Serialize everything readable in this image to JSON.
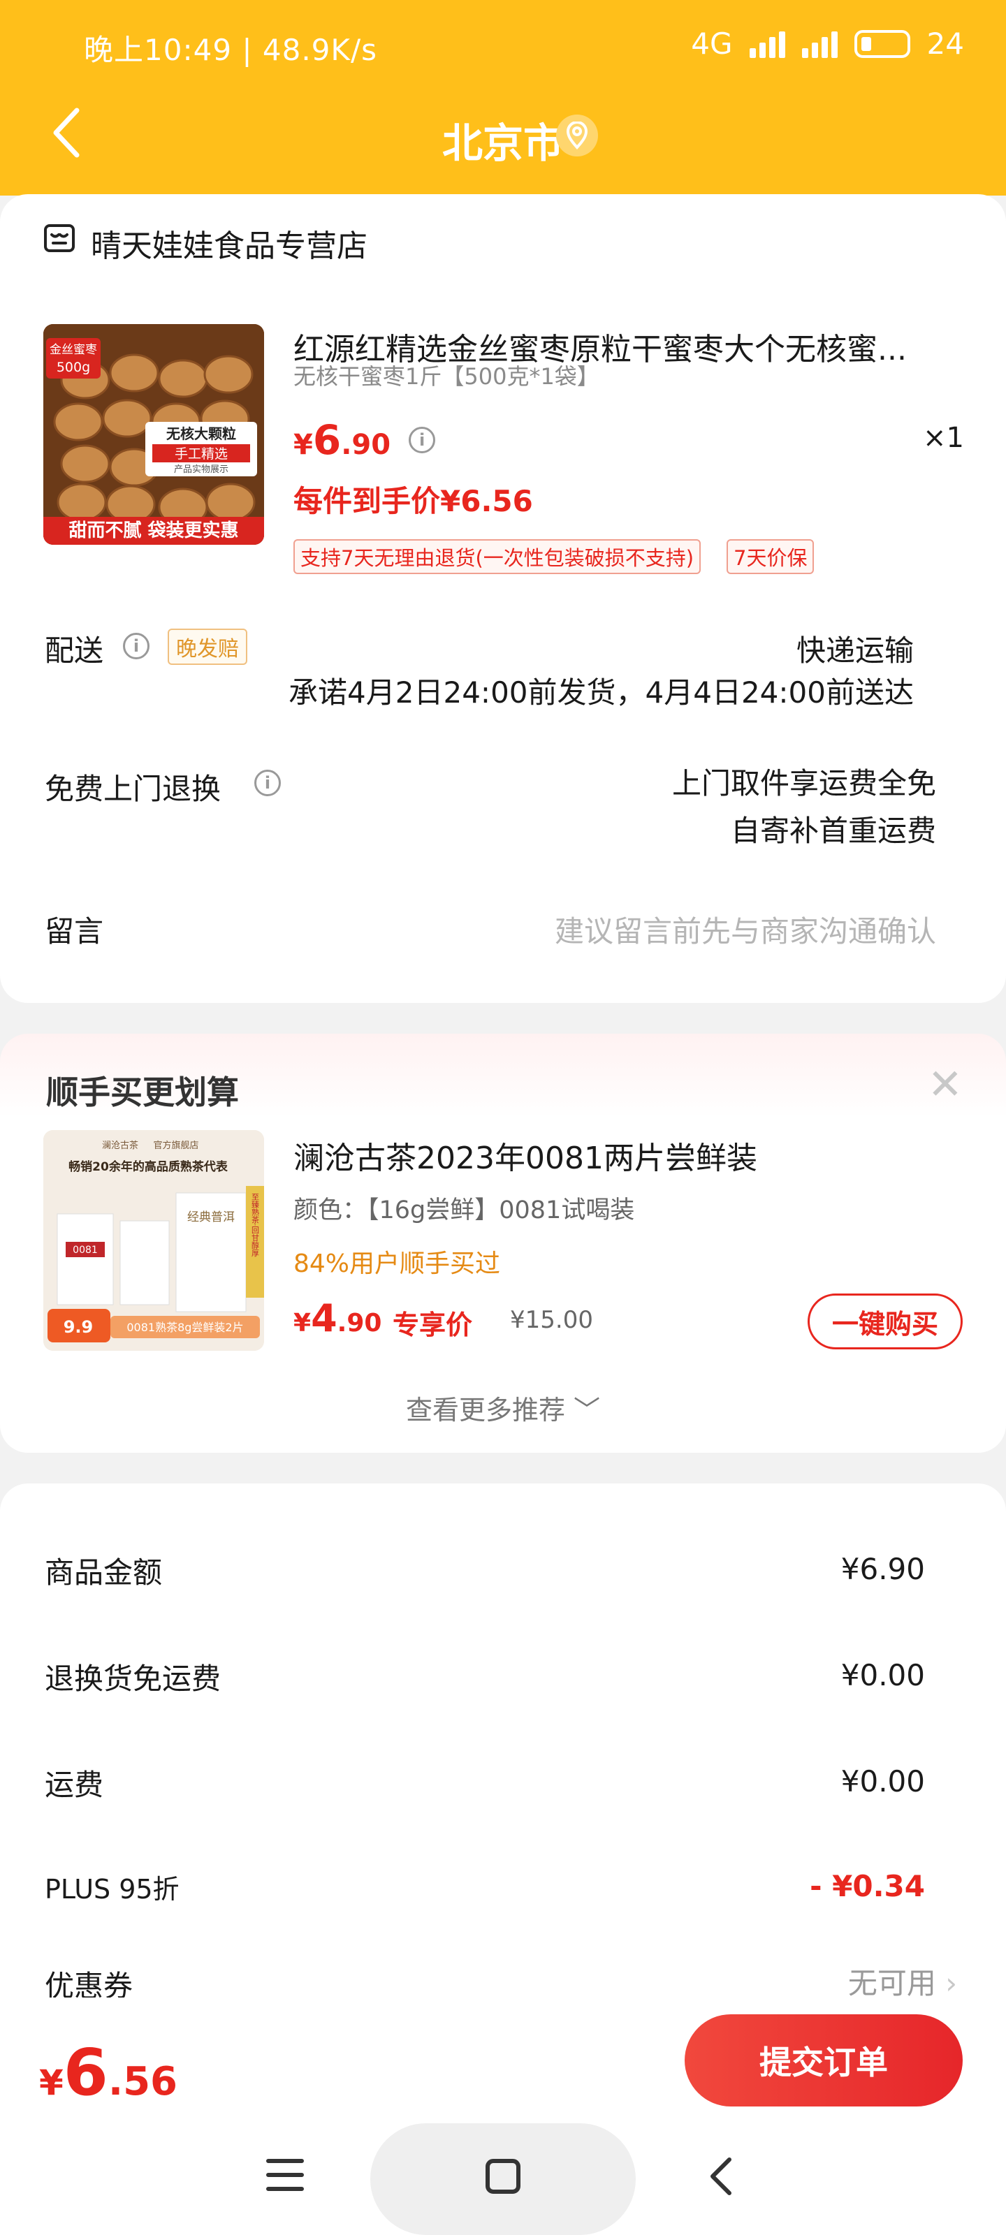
{
  "status": {
    "time": "晚上10:49 | 48.9K/s",
    "network": "4G",
    "battery": "24"
  },
  "nav": {
    "title": "北京市"
  },
  "store": {
    "name": "晴天娃娃食品专营店"
  },
  "product": {
    "image_texts": {
      "badge1": "金丝蜜枣",
      "badge2": "500g",
      "sticker1": "无核大颗粒",
      "sticker2": "手工精选",
      "sticker3": "产品实物展示",
      "bottom": "甜而不腻 袋装更实惠"
    },
    "title": "红源红精选金丝蜜枣原粒干蜜枣大个无核蜜...",
    "spec": "无核干蜜枣1斤【500克*1袋】",
    "price_symbol": "¥",
    "price_int": "6",
    "price_dec": ".90",
    "qty": "×1",
    "unit_price": "每件到手价¥6.56",
    "tags": [
      "支持7天无理由退货(一次性包装破损不支持)",
      "7天价保"
    ]
  },
  "delivery": {
    "label": "配送",
    "late_tag": "晚发赔",
    "method": "快递运输",
    "promise": "承诺4月2日24:00前发货，4月4日24:00前送达"
  },
  "return_service": {
    "label": "免费上门退换",
    "line1": "上门取件享运费全免",
    "line2": "自寄补首重运费"
  },
  "message": {
    "label": "留言",
    "hint": "建议留言前先与商家沟通确认"
  },
  "recommend": {
    "title": "顺手买更划算",
    "image_texts": {
      "brand": "澜沧古茶",
      "store": "官方旗舰店",
      "head": "畅销20余年的高品质熟茶代表",
      "mid": "经典普洱",
      "code": "0081",
      "side": "至臻熟茶·回甘醇厚",
      "price": "9.9",
      "foot": "0081熟茶8g尝鲜装2片"
    },
    "name": "澜沧古茶2023年0081两片尝鲜装",
    "color": "颜色：【16g尝鲜】0081试喝装",
    "bought": "84%用户顺手买过",
    "price_symbol": "¥",
    "price_int": "4",
    "price_dec": ".90",
    "exclusive": "专享价",
    "orig": "¥15.00",
    "buy": "一键购买",
    "more": "查看更多推荐"
  },
  "summary": [
    {
      "label": "商品金额",
      "value": "¥6.90"
    },
    {
      "label": "退换货免运费",
      "value": "¥0.00"
    },
    {
      "label": "运费",
      "value": "¥0.00"
    },
    {
      "label": "PLUS 95折",
      "value": "- ¥0.34"
    },
    {
      "label": "优惠券",
      "value": "无可用"
    }
  ],
  "footer": {
    "total_symbol": "¥",
    "total_int": "6",
    "total_dec": ".56",
    "submit": "提交订单"
  },
  "colors": {
    "header": "#ffbf1a",
    "accent_red": "#e8261e",
    "orange": "#e58a14"
  }
}
